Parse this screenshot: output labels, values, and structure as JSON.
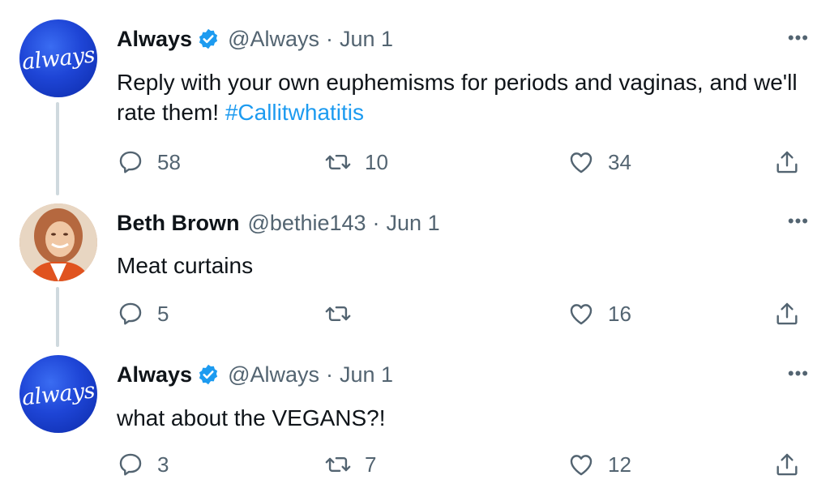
{
  "tweets": [
    {
      "name": "Always",
      "handle": "@Always",
      "date": "Jun 1",
      "avatar_text": "always",
      "text": "Reply with your own euphemisms for periods and vaginas, and we'll rate them! ",
      "hashtag": "#Callitwhatitis",
      "replies": "58",
      "retweets": "10",
      "likes": "34"
    },
    {
      "name": "Beth Brown",
      "handle": "@bethie143",
      "date": "Jun 1",
      "text": "Meat curtains",
      "replies": "5",
      "retweets": "",
      "likes": "16"
    },
    {
      "name": "Always",
      "handle": "@Always",
      "date": "Jun 1",
      "avatar_text": "always",
      "text": "what about the VEGANS?!",
      "replies": "3",
      "retweets": "7",
      "likes": "12"
    }
  ],
  "separator": "·",
  "more_glyph": "•••",
  "colors": {
    "text": "#0f1419",
    "muted": "#536471",
    "link": "#1d9bf0",
    "verified": "#1d9bf0",
    "thread_line": "#cfd9de"
  },
  "icons": [
    "verified-badge-icon",
    "reply-icon",
    "retweet-icon",
    "like-icon",
    "share-icon",
    "more-icon"
  ]
}
